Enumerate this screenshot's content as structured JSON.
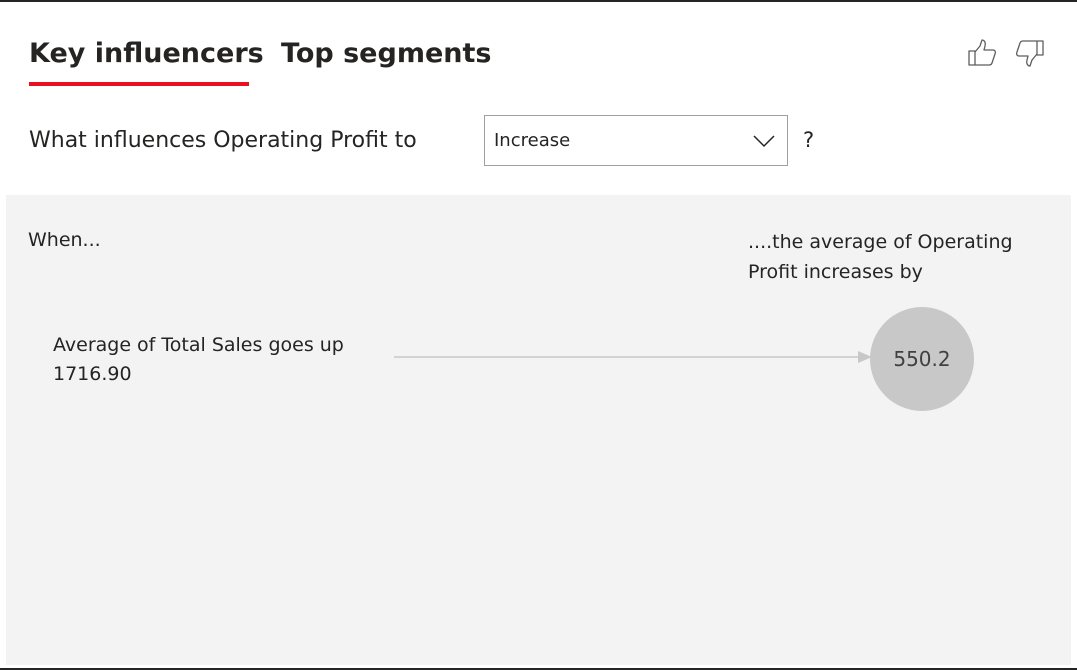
{
  "tabs": [
    {
      "label": "Key influencers",
      "active": true
    },
    {
      "label": "Top segments",
      "active": false
    }
  ],
  "feedback": {
    "like_icon": "thumbs-up-icon",
    "dislike_icon": "thumbs-down-icon"
  },
  "question": {
    "prefix": "What influences Operating Profit to",
    "selected": "Increase",
    "suffix": "?"
  },
  "panel": {
    "when_label": "When...",
    "result_label": "....the average of Operating Profit increases by",
    "influencers": [
      {
        "label": "Average of Total Sales goes up 1716.90",
        "value": "550.2"
      }
    ]
  },
  "colors": {
    "accent": "#e81123",
    "panel_bg": "#f3f3f3",
    "bubble": "#c8c8c8",
    "connector": "#c8c8c8"
  }
}
